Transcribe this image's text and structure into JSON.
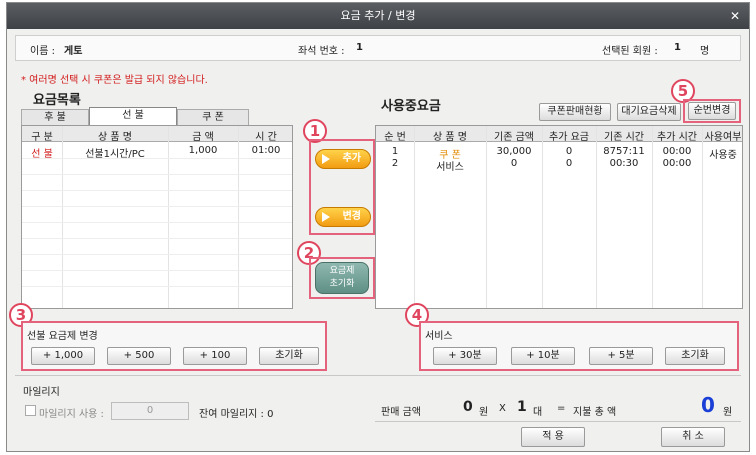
{
  "window": {
    "title": "요금 추가 / 변경",
    "close_glyph": "✕"
  },
  "info": {
    "name_label": "이름 :",
    "name_value": "게토",
    "seat_label": "좌석 번호 :",
    "seat_value": "1",
    "selected_label": "선택된 회원 :",
    "selected_value": "1",
    "selected_unit": "명"
  },
  "warning": "* 여러명 선택 시 쿠폰은 발급 되지 않습니다.",
  "left": {
    "title": "요금목록",
    "tabs": [
      {
        "label": "후 불",
        "active": false
      },
      {
        "label": "선 불",
        "active": true
      },
      {
        "label": "쿠 폰",
        "active": false
      }
    ],
    "columns": [
      "구 분",
      "상 품 명",
      "금 액",
      "시 간"
    ],
    "rows": [
      {
        "type": "선 불",
        "product": "선불1시간/PC",
        "amount": "1,000",
        "time": "01:00"
      }
    ]
  },
  "middle": {
    "add_label": "추가",
    "change_label": "변경",
    "reset_label_1": "요금제",
    "reset_label_2": "초기화"
  },
  "right": {
    "title": "사용중요금",
    "buttons": {
      "coupon_sales": "쿠폰판매현황",
      "delete_waiting": "대기요금삭제",
      "reorder": "순번변경"
    },
    "columns": [
      "순 번",
      "상 품 명",
      "기존 금액",
      "추가 요금",
      "기존 시간",
      "추가 시간",
      "사용여부"
    ],
    "rows": [
      {
        "no": "1",
        "product": "쿠 폰",
        "base_amount": "30,000",
        "add_fee": "0",
        "base_time": "8757:11",
        "add_time": "00:00",
        "status": "사용중"
      },
      {
        "no": "2",
        "product": "서비스",
        "base_amount": "0",
        "add_fee": "0",
        "base_time": "00:30",
        "add_time": "00:00",
        "status": ""
      }
    ]
  },
  "prepaid_group": {
    "title": "선불 요금제 변경",
    "buttons": [
      "+ 1,000",
      "+ 500",
      "+ 100",
      "초기화"
    ]
  },
  "service_group": {
    "title": "서비스",
    "buttons": [
      "+ 30분",
      "+ 10분",
      "+ 5분",
      "초기화"
    ]
  },
  "mileage": {
    "title": "마일리지",
    "use_label": "마일리지 사용 :",
    "use_value": "0",
    "remaining_label": "잔여 마일리지 : 0"
  },
  "summary": {
    "sale_label": "판매 금액",
    "amount": "0",
    "won": "원",
    "x": "X",
    "count": "1",
    "count_unit": "대",
    "eq": "=",
    "total_label": "지불 총 액",
    "total": "0",
    "total_unit": "원"
  },
  "footer": {
    "apply": "적 용",
    "cancel": "취 소"
  },
  "annotations": [
    "1",
    "2",
    "3",
    "4",
    "5"
  ],
  "colors": {
    "accent": "#e4627c",
    "warning": "#d21c1c",
    "total": "#1a3fd6",
    "coupon": "#e08a00",
    "prepaid": "#d21c1c"
  }
}
